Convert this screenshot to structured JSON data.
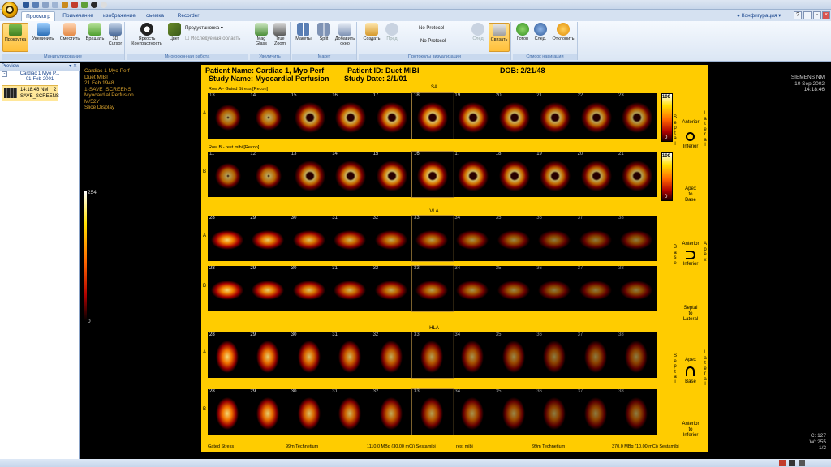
{
  "tabs": [
    "Просмотр",
    "Примечание",
    "изображение",
    "съемка",
    "Recorder"
  ],
  "config_label": "Конфигурация",
  "ribbon": {
    "buttons": [
      {
        "label": "Прокрутка",
        "active": true
      },
      {
        "label": "Увеличить"
      },
      {
        "label": "Сместить"
      },
      {
        "label": "Вращать"
      },
      {
        "label": "3D Cursor"
      },
      {
        "label": "Яркость Контрастность"
      },
      {
        "label": "Цвет"
      },
      {
        "label": "Mag Glass"
      },
      {
        "label": "True Zoom"
      },
      {
        "label": "Макеты"
      },
      {
        "label": "Split"
      },
      {
        "label": "Добавить окно"
      },
      {
        "label": "Создать"
      },
      {
        "label": "Пред"
      },
      {
        "label": "След"
      },
      {
        "label": "Связать",
        "active": true
      },
      {
        "label": "Готов"
      },
      {
        "label": "След."
      },
      {
        "label": "Отклонить"
      }
    ],
    "preset_label": "Предустановка",
    "checkbox_label": "Исследуемая область",
    "protocol1": "No Protocol",
    "protocol2": "No Protocol",
    "groups": [
      "Манипулирование",
      "Многооконная работа",
      "Увеличить",
      "Макет",
      "Протоколы визуализации",
      "Список навигации"
    ]
  },
  "preview": {
    "title": "Preview",
    "patient_short": "Cardiac 1 Myo P...",
    "date": "01-Feb-2001",
    "thumb_time": "14:18:46 NM",
    "thumb_count": "2",
    "thumb_name": "SAVE_SCREENS"
  },
  "overlay_left": [
    "Cardiac 1 Myo Perf",
    "Duet MIBI",
    "21 Feb 1948",
    "1-SAVE_SCREENS",
    "Myocardial Perfusion",
    "M/52Y",
    "Slice Display"
  ],
  "overlay_right": [
    "SIEMENS NM",
    "10 Sep 2002",
    "14:18:46"
  ],
  "overlay_bottom_right": [
    "C: 127",
    "W: 255",
    "1/2"
  ],
  "colorbar": {
    "max": "254",
    "min": "0"
  },
  "header": {
    "patient_name_label": "Patient Name:",
    "patient_name": "Cardiac 1, Myo Perf",
    "patient_id_label": "Patient ID:",
    "patient_id": "Duet MIBI",
    "dob_label": "DOB:",
    "dob": "2/21/48",
    "study_name_label": "Study Name:",
    "study_name": "Myocardial Perfusion",
    "study_date_label": "Study Date:",
    "study_date": "2/1/01"
  },
  "sections": [
    {
      "name": "SA",
      "rows": [
        {
          "label": "Row A - Gated Stress [Recon]",
          "letter": "A",
          "nums": [
            "13",
            "14",
            "15",
            "16",
            "17",
            "18",
            "19",
            "20",
            "21",
            "22",
            "23"
          ]
        },
        {
          "label": "Row B - rest mibi [Recon]",
          "letter": "B",
          "nums": [
            "11",
            "12",
            "13",
            "14",
            "15",
            "16",
            "17",
            "18",
            "19",
            "20",
            "21"
          ]
        }
      ]
    },
    {
      "name": "VLA",
      "rows": [
        {
          "label": "",
          "letter": "A",
          "nums": [
            "28",
            "29",
            "30",
            "31",
            "32",
            "33",
            "34",
            "35",
            "36",
            "37",
            "38"
          ]
        },
        {
          "label": "",
          "letter": "B",
          "nums": [
            "28",
            "29",
            "30",
            "31",
            "32",
            "33",
            "34",
            "35",
            "36",
            "37",
            "38"
          ]
        }
      ]
    },
    {
      "name": "HLA",
      "rows": [
        {
          "label": "",
          "letter": "A",
          "nums": [
            "28",
            "29",
            "30",
            "31",
            "32",
            "33",
            "34",
            "35",
            "36",
            "37",
            "38"
          ]
        },
        {
          "label": "",
          "letter": "B",
          "nums": [
            "28",
            "29",
            "30",
            "31",
            "32",
            "33",
            "34",
            "35",
            "36",
            "37",
            "38"
          ]
        }
      ]
    }
  ],
  "scales": {
    "max": "100",
    "min": "0"
  },
  "orientation": {
    "sa_anterior": "Anterior",
    "sa_inferior": "Inferior",
    "sa_septal": "Septal",
    "sa_lateral": "Lateral",
    "sa_apex_to_base": [
      "Apex",
      "to",
      "Base"
    ],
    "vla_anterior": "Anterior",
    "vla_inferior": "Inferior",
    "vla_base": "Base",
    "vla_apex": "Apex",
    "vla_septal_to_lateral": [
      "Septal",
      "to",
      "Lateral"
    ],
    "hla_apex": "Apex",
    "hla_base": "Base",
    "hla_septal": "Septal",
    "hla_lateral": "Lateral",
    "hla_anterior_to_inferior": [
      "Anterior",
      "to",
      "Inferior"
    ]
  },
  "footer": [
    "Gated Stress",
    "99m Technetium",
    "1110.0 MBq (30.00 mCi) Sestamibi",
    "rest mibi",
    "99m Technetium",
    "370.0 MBq (10.00 mCi) Sestamibi"
  ]
}
